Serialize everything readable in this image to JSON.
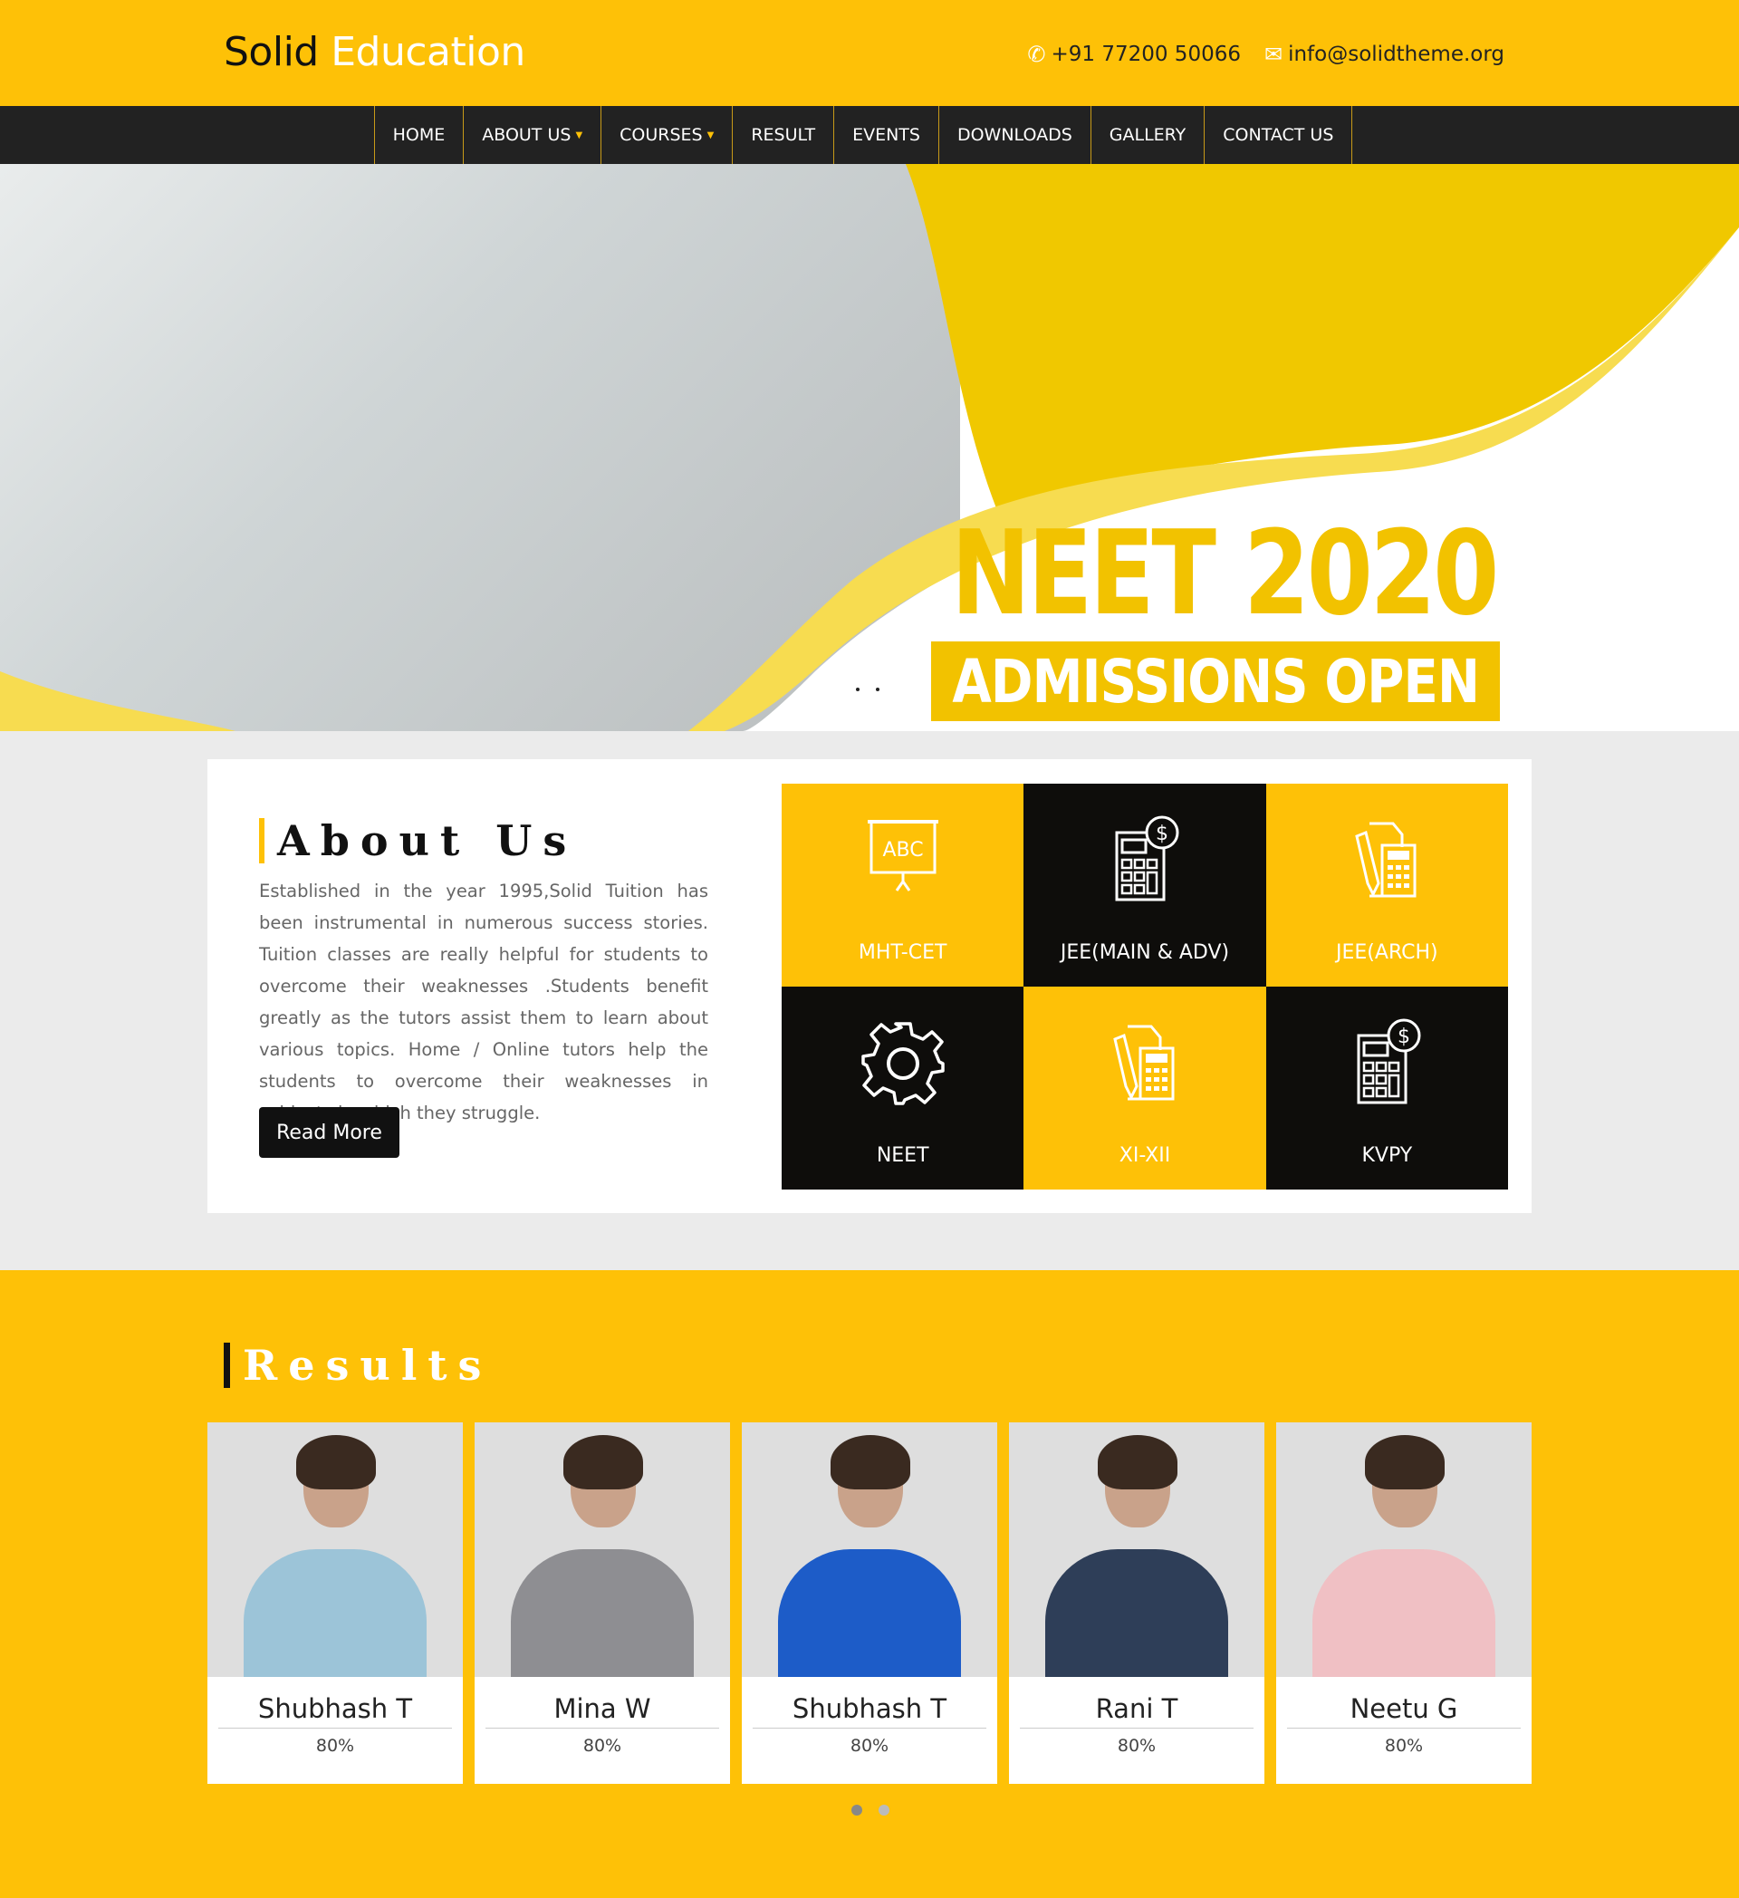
{
  "header": {
    "logo_dark": "Solid",
    "logo_light": "Education",
    "phone": "+91 77200 50066",
    "email": "info@solidtheme.org",
    "phone_icon": "phone-icon",
    "email_icon": "envelope-icon"
  },
  "nav": {
    "items": [
      {
        "label": "HOME"
      },
      {
        "label": "ABOUT US",
        "dropdown": true
      },
      {
        "label": "COURSES",
        "dropdown": true
      },
      {
        "label": "RESULT"
      },
      {
        "label": "EVENTS"
      },
      {
        "label": "DOWNLOADS"
      },
      {
        "label": "GALLERY"
      },
      {
        "label": "CONTACT US"
      }
    ]
  },
  "hero": {
    "title": "NEET 2020",
    "subtitle": "ADMISSIONS OPEN",
    "slides": 2
  },
  "about": {
    "heading": "About Us",
    "text": "Established in the year 1995,Solid Tuition has been instrumental in numerous success stories. Tuition classes are really helpful for students to overcome their weaknesses .Students benefit greatly as the tutors assist them to learn about various topics. Home / Online tutors help the students to overcome their weaknesses in subjects in which they struggle.",
    "button": "Read More"
  },
  "courses": [
    {
      "label": "MHT-CET",
      "icon": "whiteboard-abc-icon",
      "bg": "#fec107"
    },
    {
      "label": "JEE(MAIN & ADV)",
      "icon": "calculator-dollar-icon",
      "bg": "#0e0d0b"
    },
    {
      "label": "JEE(ARCH)",
      "icon": "pencil-calculator-icon",
      "bg": "#fec107"
    },
    {
      "label": "NEET",
      "icon": "gear-icon",
      "bg": "#0e0d0b"
    },
    {
      "label": "XI-XII",
      "icon": "pencil-calculator-icon",
      "bg": "#fec107"
    },
    {
      "label": "KVPY",
      "icon": "calculator-dollar-icon",
      "bg": "#0e0d0b"
    }
  ],
  "results": {
    "heading": "Results",
    "students": [
      {
        "name": "Shubhash T",
        "score": "80%"
      },
      {
        "name": "Mina W",
        "score": "80%"
      },
      {
        "name": "Shubhash T",
        "score": "80%"
      },
      {
        "name": "Rani T",
        "score": "80%"
      },
      {
        "name": "Neetu G",
        "score": "80%"
      }
    ],
    "pages": 2
  },
  "colors": {
    "accent": "#fec107",
    "dark": "#222222"
  }
}
